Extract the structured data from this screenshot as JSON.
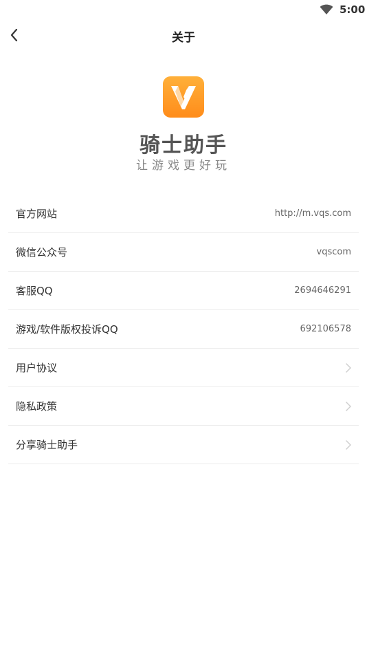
{
  "status_bar": {
    "time": "5:00",
    "icons": [
      "wifi-icon"
    ]
  },
  "header": {
    "title": "关于",
    "back_icon": "chevron-left-icon"
  },
  "brand": {
    "name": "骑士助手",
    "slogan": "让游戏更好玩",
    "logo_color": "#FF9F1C",
    "logo_icon": "v-logo-icon"
  },
  "list": {
    "items": [
      {
        "label": "官方网站",
        "value": "http://m.vqs.com"
      },
      {
        "label": "微信公众号",
        "value": "vqscom"
      },
      {
        "label": "客服QQ",
        "value": "2694646291"
      },
      {
        "label": "游戏/软件版权投诉QQ",
        "value": "692106578"
      },
      {
        "label": "用户协议",
        "value": null
      },
      {
        "label": "隐私政策",
        "value": null
      },
      {
        "label": "分享骑士助手",
        "value": null
      }
    ]
  }
}
